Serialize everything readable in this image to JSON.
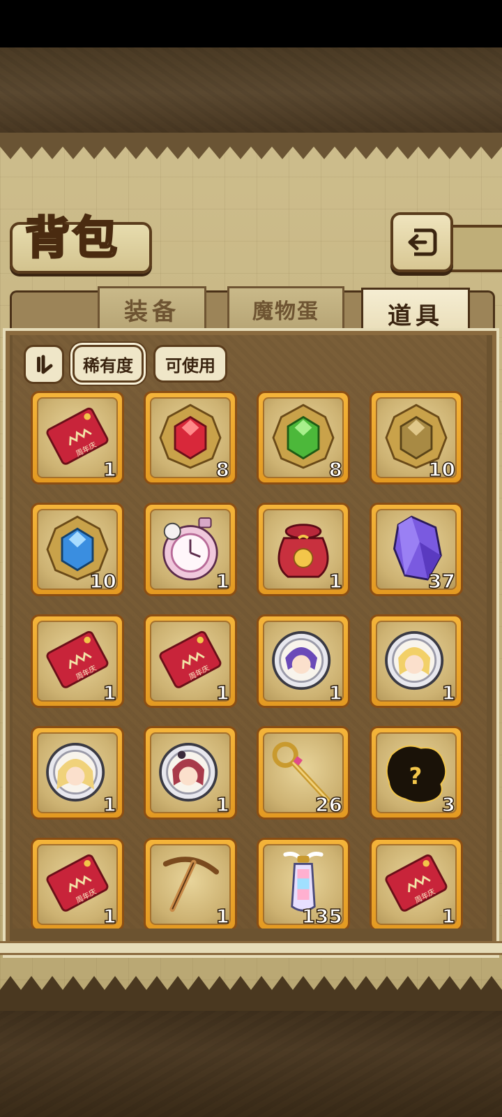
{
  "header": {
    "title": "背包"
  },
  "tabs": [
    {
      "label": "装备",
      "active": false
    },
    {
      "label": "魔物蛋",
      "active": false
    },
    {
      "label": "道具",
      "active": true
    }
  ],
  "filters": [
    {
      "label": "稀有度",
      "selected": true
    },
    {
      "label": "可使用",
      "selected": false
    }
  ],
  "items": [
    {
      "icon": "anniversary-red-envelope-icon",
      "count": "1"
    },
    {
      "icon": "red-gem-icon",
      "count": "8"
    },
    {
      "icon": "green-gem-icon",
      "count": "8"
    },
    {
      "icon": "bronze-gem-icon",
      "count": "10"
    },
    {
      "icon": "blue-gem-icon",
      "count": "10"
    },
    {
      "icon": "pink-pocket-watch-icon",
      "count": "1"
    },
    {
      "icon": "lucky-bag-icon",
      "count": "1"
    },
    {
      "icon": "purple-crystal-icon",
      "count": "37"
    },
    {
      "icon": "anniversary-red-envelope-icon",
      "count": "1"
    },
    {
      "icon": "anniversary-red-envelope-icon",
      "count": "1"
    },
    {
      "icon": "character-medal-purple-hair-icon",
      "count": "1"
    },
    {
      "icon": "character-medal-blonde-icon",
      "count": "1"
    },
    {
      "icon": "character-medal-blonde-twin-icon",
      "count": "1"
    },
    {
      "icon": "character-medal-red-hair-icon",
      "count": "1"
    },
    {
      "icon": "golden-key-wand-icon",
      "count": "26"
    },
    {
      "icon": "mystery-silhouette-icon",
      "count": "3"
    },
    {
      "icon": "anniversary-red-envelope-icon",
      "count": "1"
    },
    {
      "icon": "pickaxe-icon",
      "count": "1"
    },
    {
      "icon": "winged-rainbow-lantern-icon",
      "count": "135"
    },
    {
      "icon": "anniversary-red-envelope-icon",
      "count": "1"
    }
  ],
  "envelope_text": "周年庆",
  "mystery_mark": "?",
  "colors": {
    "slot_gold": "#f4b43a",
    "frame_brown": "#5a3c1c",
    "parchment": "#c4b27e",
    "envelope_red": "#c8243a"
  }
}
